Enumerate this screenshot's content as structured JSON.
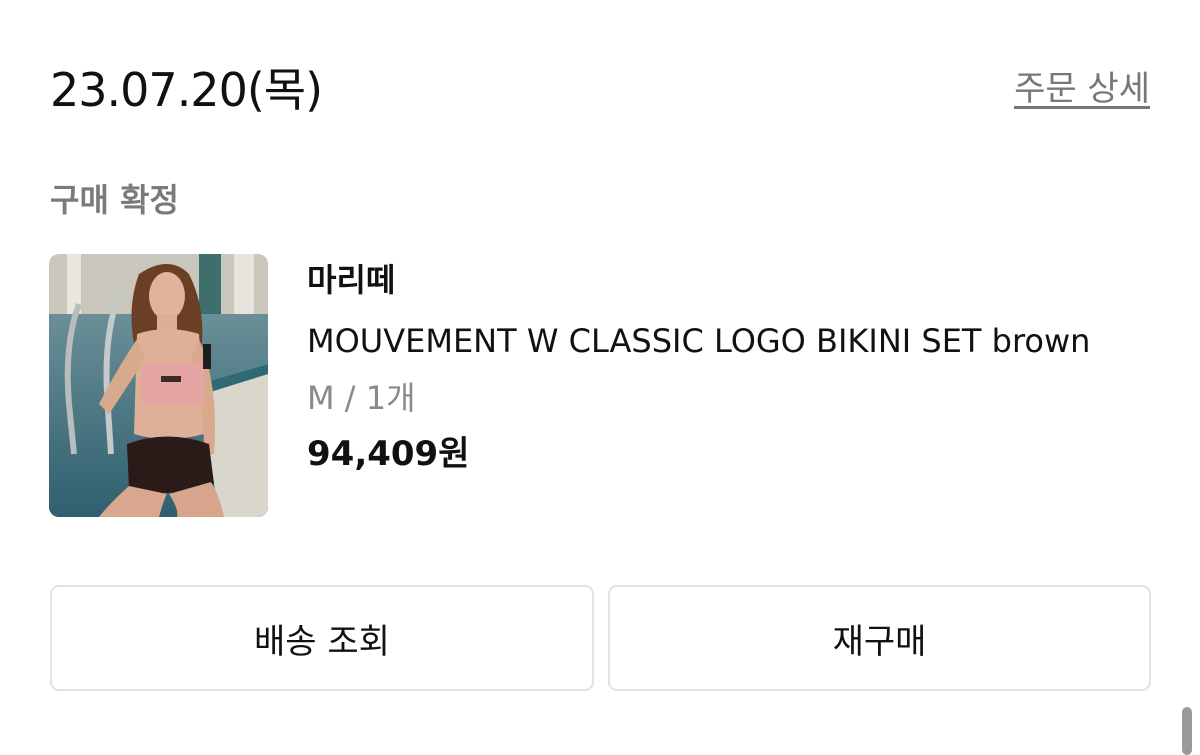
{
  "order": {
    "date": "23.07.20(목)",
    "detail_link": "주문 상세",
    "status": "구매 확정"
  },
  "product": {
    "brand": "마리떼",
    "name": "MOUVEMENT W CLASSIC LOGO BIKINI SET brown",
    "option": "M / 1개",
    "price": "94,409원",
    "image_icon": "product-photo"
  },
  "actions": {
    "tracking_label": "배송 조회",
    "reorder_label": "재구매"
  },
  "colors": {
    "text_primary": "#111111",
    "text_secondary": "#8a8a8a",
    "button_border": "#e2e2e2"
  }
}
